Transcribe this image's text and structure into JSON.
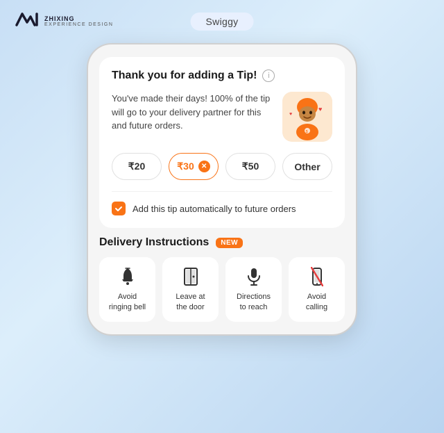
{
  "topbar": {
    "logo": "ZXD",
    "brand": "ZHIXING",
    "tagline": "EXPERIENCE  DESIGN",
    "app_label": "Swiggy"
  },
  "tip_section": {
    "title": "Thank you for adding a Tip!",
    "info_icon": "ℹ",
    "message": "You've made their days! 100% of the tip will go to your delivery partner for this and future orders.",
    "amounts": [
      {
        "label": "₹20",
        "selected": false
      },
      {
        "label": "₹30",
        "selected": true
      },
      {
        "label": "₹50",
        "selected": false
      },
      {
        "label": "Other",
        "selected": false
      }
    ],
    "auto_tip_label": "Add this tip automatically to future orders"
  },
  "delivery_instructions": {
    "title": "Delivery Instructions",
    "badge": "NEW",
    "items": [
      {
        "icon": "🔔",
        "label": "Avoid\nringing bell",
        "unicode": "bell"
      },
      {
        "icon": "🚪",
        "label": "Leave at\nthe door",
        "unicode": "door"
      },
      {
        "icon": "🎙",
        "label": "Directions\nto reach",
        "unicode": "mic"
      },
      {
        "icon": "📵",
        "label": "Avoid\ncalling",
        "unicode": "no-phone"
      }
    ]
  }
}
